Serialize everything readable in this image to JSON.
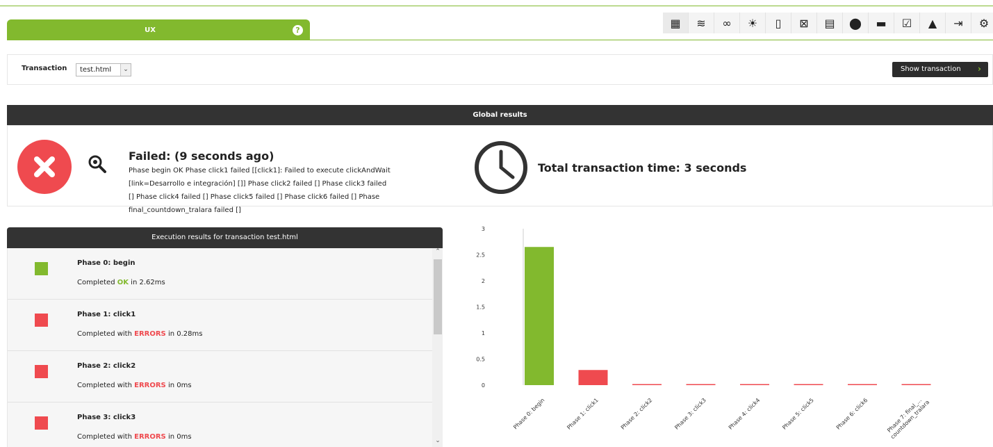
{
  "tab": {
    "title": "UX",
    "help_symbol": "?"
  },
  "toolbar": {
    "icons": [
      {
        "name": "agent-view-icon",
        "glyph": "▦"
      },
      {
        "name": "network-icon",
        "glyph": "≋"
      },
      {
        "name": "link-icon",
        "glyph": "∞"
      },
      {
        "name": "sun-icon",
        "glyph": "☀"
      },
      {
        "name": "book-icon",
        "glyph": "▯"
      },
      {
        "name": "graph-icon",
        "glyph": "⊠"
      },
      {
        "name": "archive-icon",
        "glyph": "▤"
      },
      {
        "name": "map-pin-icon",
        "glyph": "⬤"
      },
      {
        "name": "folder-icon",
        "glyph": "▬"
      },
      {
        "name": "checklist-icon",
        "glyph": "☑"
      },
      {
        "name": "bell-icon",
        "glyph": "▲"
      },
      {
        "name": "logout-icon",
        "glyph": "⇥"
      },
      {
        "name": "gear-icon",
        "glyph": "⚙"
      }
    ]
  },
  "transaction": {
    "label": "Transaction",
    "selected": "test.html",
    "arrow": "⌄",
    "show_button": "Show transaction",
    "show_arrow": "›"
  },
  "global": {
    "header": "Global results",
    "status_title": "Failed: (9 seconds ago)",
    "status_desc": "Phase begin OK Phase click1 failed [[click1]: Failed to execute clickAndWait [link=Desarrollo e integración] []] Phase click2 failed [] Phase click3 failed [] Phase click4 failed [] Phase click5 failed [] Phase click6 failed [] Phase final_countdown_tralara failed []",
    "total_time": "Total transaction time: 3 seconds"
  },
  "execution": {
    "header": "Execution results for transaction test.html",
    "phases": [
      {
        "name": "Phase 0: begin",
        "prefix": "Completed ",
        "status": "OK",
        "suffix": " in 2.62ms",
        "ok": true
      },
      {
        "name": "Phase 1: click1",
        "prefix": "Completed with ",
        "status": "ERRORS",
        "suffix": " in 0.28ms",
        "ok": false
      },
      {
        "name": "Phase 2: click2",
        "prefix": "Completed with ",
        "status": "ERRORS",
        "suffix": " in 0ms",
        "ok": false
      },
      {
        "name": "Phase 3: click3",
        "prefix": "Completed with ",
        "status": "ERRORS",
        "suffix": " in 0ms",
        "ok": false
      }
    ],
    "scroll_up": "⌃",
    "scroll_down": "⌄"
  },
  "colors": {
    "ok": "#82b92e",
    "error": "#ef4a4f",
    "dark": "#333333"
  },
  "chart_data": {
    "type": "bar",
    "categories": [
      "Phase 0: begin",
      "Phase 1: click1",
      "Phase 2: click2",
      "Phase 3: click3",
      "Phase 4: click4",
      "Phase 5: click5",
      "Phase 6: click6",
      "Phase 7: final_countdown_tralara"
    ],
    "category_labels": [
      "Phase 0: begin",
      "Phase 1: click1",
      "Phase 2: click2",
      "Phase 3: click3",
      "Phase 4: click4",
      "Phase 5: click5",
      "Phase 6: click6",
      "Phase 7: final_... countdown_tralara"
    ],
    "values": [
      2.65,
      0.29,
      0.02,
      0.02,
      0.02,
      0.02,
      0.02,
      0.02
    ],
    "bar_colors": [
      "#82b92e",
      "#ef4a4f",
      "#ef4a4f",
      "#ef4a4f",
      "#ef4a4f",
      "#ef4a4f",
      "#ef4a4f",
      "#ef4a4f"
    ],
    "yticks": [
      0,
      0.5,
      1,
      1.5,
      2,
      2.5,
      3
    ],
    "ylim": [
      0,
      3
    ],
    "xlabel": "",
    "ylabel": "",
    "title": ""
  }
}
